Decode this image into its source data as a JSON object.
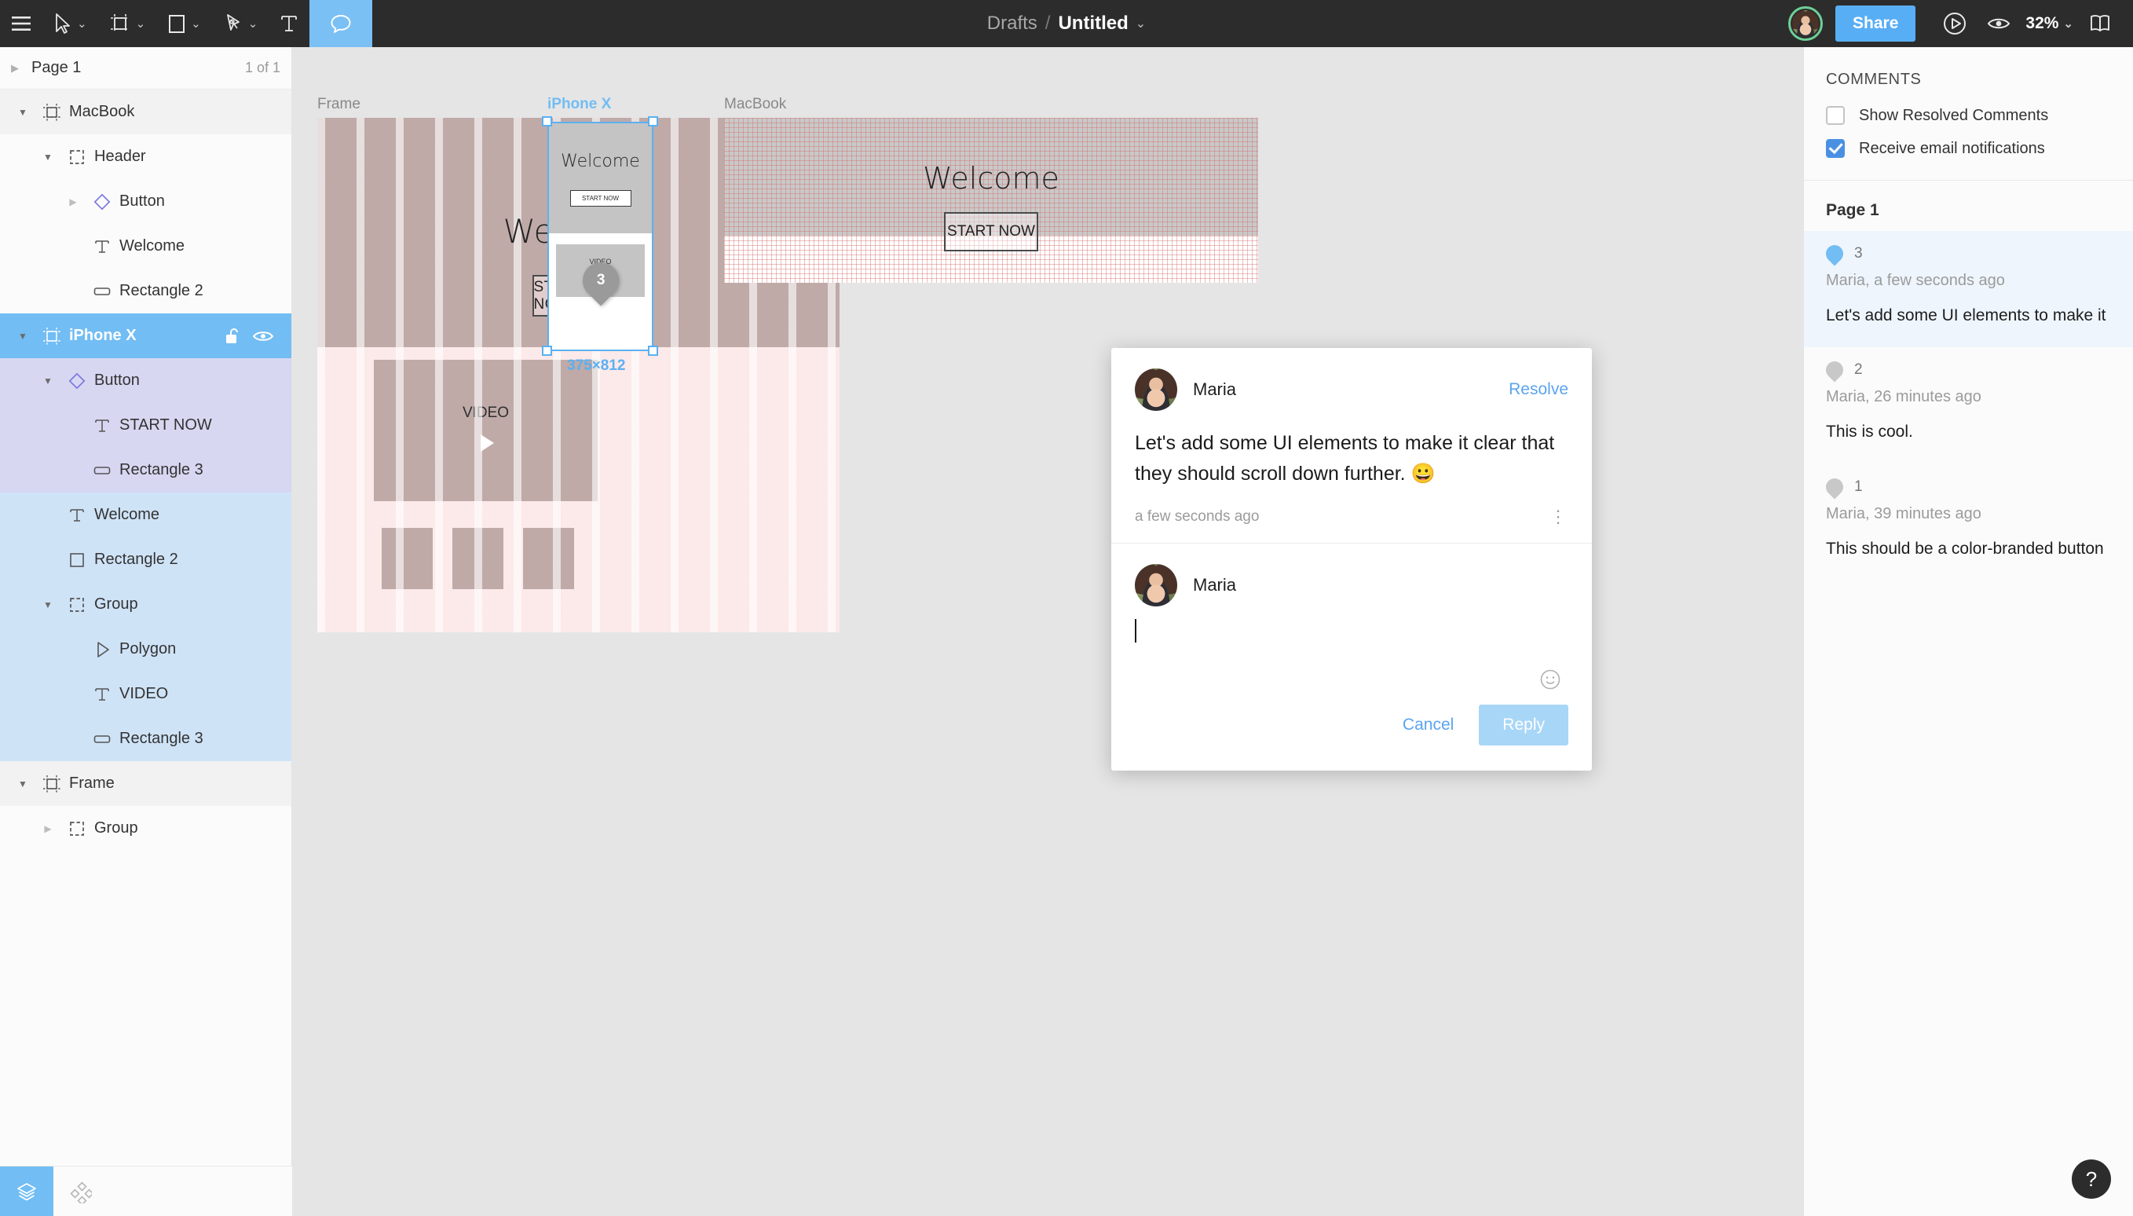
{
  "toolbar": {
    "menu_icon": "hamburger-menu-icon",
    "tools": [
      {
        "name": "move-tool",
        "icon": "cursor-arrow-icon",
        "has_caret": true,
        "active": false
      },
      {
        "name": "frame-tool",
        "icon": "frame-crop-icon",
        "has_caret": true,
        "active": false
      },
      {
        "name": "shape-tool",
        "icon": "rectangle-icon",
        "has_caret": true,
        "active": false
      },
      {
        "name": "pen-tool",
        "icon": "pen-nib-icon",
        "has_caret": true,
        "active": false
      },
      {
        "name": "text-tool",
        "icon": "text-t-icon",
        "has_caret": false,
        "active": false
      },
      {
        "name": "comment-tool",
        "icon": "speech-bubble-icon",
        "has_caret": false,
        "active": true
      }
    ],
    "breadcrumb_project": "Drafts",
    "breadcrumb_separator": "/",
    "breadcrumb_file": "Untitled",
    "file_caret": "chevron-down-icon",
    "share_label": "Share",
    "present_icon": "play-circle-icon",
    "view_icon": "eye-icon",
    "zoom_level": "32%",
    "zoom_caret": "chevron-down-icon",
    "panel_toggle_icon": "book-open-icon",
    "avatar_name": "Maria"
  },
  "layers_panel": {
    "page_label": "Page 1",
    "page_count": "1 of 1",
    "page_arrow": "chevron-right-icon",
    "layers": [
      {
        "label": "MacBook",
        "icon": "frame-icon",
        "indent": 0,
        "arrow": "down",
        "state": "frame-highlight"
      },
      {
        "label": "Header",
        "icon": "group-icon",
        "indent": 1,
        "arrow": "down",
        "state": "normal"
      },
      {
        "label": "Button",
        "icon": "component-icon",
        "indent": 2,
        "arrow": "right-light",
        "state": "normal"
      },
      {
        "label": "Welcome",
        "icon": "text-icon",
        "indent": 2,
        "arrow": "none",
        "state": "normal"
      },
      {
        "label": "Rectangle 2",
        "icon": "rounded-rect-icon",
        "indent": 2,
        "arrow": "none",
        "state": "normal"
      },
      {
        "label": "iPhone X",
        "icon": "frame-icon",
        "indent": 0,
        "arrow": "down",
        "state": "selected-blue",
        "lock_icon": "unlock-icon",
        "visibility_icon": "eye-icon"
      },
      {
        "label": "Button",
        "icon": "component-icon",
        "indent": 1,
        "arrow": "down",
        "state": "lavender"
      },
      {
        "label": "START NOW",
        "icon": "text-icon",
        "indent": 2,
        "arrow": "none",
        "state": "lavender"
      },
      {
        "label": "Rectangle 3",
        "icon": "rounded-rect-icon",
        "indent": 2,
        "arrow": "none",
        "state": "lavender"
      },
      {
        "label": "Welcome",
        "icon": "text-icon",
        "indent": 1,
        "arrow": "none",
        "state": "lightblue"
      },
      {
        "label": "Rectangle 2",
        "icon": "square-icon",
        "indent": 1,
        "arrow": "none",
        "state": "lightblue"
      },
      {
        "label": "Group",
        "icon": "group-icon",
        "indent": 1,
        "arrow": "down",
        "state": "lightblue"
      },
      {
        "label": "Polygon",
        "icon": "triangle-icon",
        "indent": 2,
        "arrow": "none",
        "state": "lightblue"
      },
      {
        "label": "VIDEO",
        "icon": "text-icon",
        "indent": 2,
        "arrow": "none",
        "state": "lightblue"
      },
      {
        "label": "Rectangle 3",
        "icon": "rounded-rect-icon",
        "indent": 2,
        "arrow": "none",
        "state": "lightblue"
      },
      {
        "label": "Frame",
        "icon": "frame-icon",
        "indent": 0,
        "arrow": "down",
        "state": "frame-highlight"
      },
      {
        "label": "Group",
        "icon": "group-icon",
        "indent": 1,
        "arrow": "right-light",
        "state": "normal"
      }
    ],
    "footer": {
      "layers_tab_icon": "layers-stack-icon",
      "components_tab_icon": "components-diamonds-icon"
    }
  },
  "canvas": {
    "artboards": [
      {
        "name": "Frame",
        "label": "Frame",
        "selected": false,
        "welcome": "Welcome",
        "cta": "START NOW",
        "video_label": "VIDEO"
      },
      {
        "name": "iPhone X",
        "label": "iPhone X",
        "selected": true,
        "welcome": "Welcome",
        "cta": "START NOW",
        "video_label": "VIDEO",
        "dimensions": "375×812",
        "pin_number": "3"
      },
      {
        "name": "MacBook",
        "label": "MacBook",
        "selected": false,
        "welcome": "Welcome",
        "cta": "START NOW"
      }
    ]
  },
  "comment_popup": {
    "author": "Maria",
    "resolve_label": "Resolve",
    "body": "Let's add some UI elements to make it clear that they should scroll down further. 😀",
    "timestamp": "a few seconds ago",
    "more_icon": "kebab-menu-icon",
    "reply_author": "Maria",
    "reply_value": "",
    "emoji_icon": "smiley-face-icon",
    "cancel_label": "Cancel",
    "reply_label": "Reply"
  },
  "comments_panel": {
    "title": "COMMENTS",
    "show_resolved_label": "Show Resolved Comments",
    "show_resolved_checked": false,
    "email_notifications_label": "Receive email notifications",
    "email_notifications_checked": true,
    "page_label": "Page 1",
    "items": [
      {
        "number": "3",
        "author_time": "Maria, a few seconds ago",
        "text": "Let's add some UI elements to make it",
        "active": true,
        "pin_color": "#72bdf3"
      },
      {
        "number": "2",
        "author_time": "Maria, 26 minutes ago",
        "text": "This is cool.",
        "active": false,
        "pin_color": "#c8c8c8"
      },
      {
        "number": "1",
        "author_time": "Maria, 39 minutes ago",
        "text": "This should be a color-branded button",
        "active": false,
        "pin_color": "#c8c8c8"
      }
    ]
  },
  "help": {
    "label": "?"
  },
  "colors": {
    "accent_blue": "#58aef5",
    "selection_blue": "#5bb0f2",
    "toolbar_bg": "#2c2c2c",
    "canvas_bg": "#e5e5e5"
  }
}
